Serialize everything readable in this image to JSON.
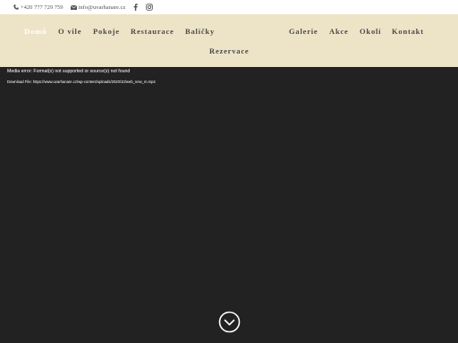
{
  "topbar": {
    "phone": "+420 777 729 759",
    "email": "info@uvarhanare.cz",
    "social": [
      "facebook-icon",
      "instagram-icon"
    ]
  },
  "nav": {
    "items": [
      {
        "label": "Domů",
        "active": true
      },
      {
        "label": "O vile"
      },
      {
        "label": "Pokoje"
      },
      {
        "label": "Restaurace"
      },
      {
        "label": "Balíčky"
      },
      {
        "label": "Galerie"
      },
      {
        "label": "Akce"
      },
      {
        "label": "Okolí"
      },
      {
        "label": "Kontakt"
      },
      {
        "label": "Rezervace"
      }
    ]
  },
  "video": {
    "error": "Media error: Format(s) not supported or source(s) not found",
    "download_prefix": "Download File: ",
    "download_link": "https://www.uvarhanare.cz/wp-content/uploads/2020/10/web_new_m.mp4"
  },
  "colors": {
    "nav_bg": "#ede4c8",
    "nav_text": "#4a4a4a",
    "active_text": "#ffffff",
    "video_bg": "#222222"
  }
}
